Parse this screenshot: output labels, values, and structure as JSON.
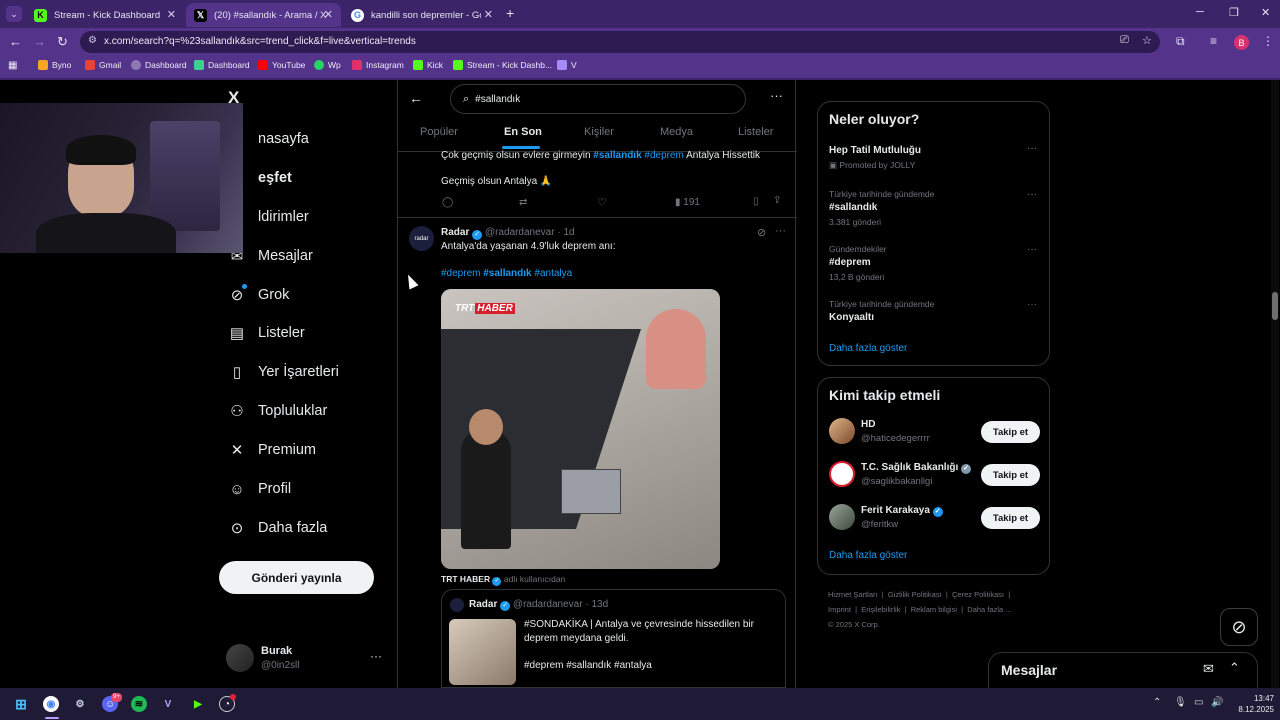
{
  "browser": {
    "tabs": [
      {
        "title": "Stream - Kick Dashboard",
        "active": false
      },
      {
        "title": "(20) #sallandık - Arama / X",
        "active": true
      },
      {
        "title": "kandilli son depremler - Google",
        "active": false
      }
    ],
    "url": "x.com/search?q=%23sallandık&src=trend_click&f=live&vertical=trends",
    "profile_initial": "B",
    "bookmarks": [
      "Byno",
      "Gmail",
      "Dashboard",
      "Dashboard",
      "YouTube",
      "Wp",
      "Instagram",
      "Kick",
      "Stream - Kick Dashb...",
      "V"
    ]
  },
  "sidebar": {
    "logo": "X",
    "items": [
      {
        "label": "nasayfa",
        "icon": "home-icon"
      },
      {
        "label": "eşfet",
        "icon": "search-icon"
      },
      {
        "label": "ldirimler",
        "icon": "bell-icon"
      },
      {
        "label": "Mesajlar",
        "icon": "mail-icon"
      },
      {
        "label": "Grok",
        "icon": "grok-icon"
      },
      {
        "label": "Listeler",
        "icon": "list-icon"
      },
      {
        "label": "Yer İşaretleri",
        "icon": "bookmark-icon"
      },
      {
        "label": "Topluluklar",
        "icon": "communities-icon"
      },
      {
        "label": "Premium",
        "icon": "x-premium-icon"
      },
      {
        "label": "Profil",
        "icon": "profile-icon"
      },
      {
        "label": "Daha fazla",
        "icon": "more-icon"
      }
    ],
    "post_button": "Gönderi yayınla",
    "account": {
      "name": "Burak",
      "handle": "@0in2sll"
    }
  },
  "search": {
    "query": "#sallandık",
    "tabs": [
      "Popüler",
      "En Son",
      "Kişiler",
      "Medya",
      "Listeler"
    ],
    "active_tab": "En Son"
  },
  "feed": {
    "prev_tweet": {
      "line1_prefix": "Çok geçmiş olsun evlere girmeyin ",
      "line1_tag1": "#sallandık",
      "line1_tag2": "#deprem",
      "line1_suffix": " Antalya Hissettik",
      "line2": "Geçmiş olsun Antalya 🙏",
      "views": "191"
    },
    "tweet": {
      "name": "Radar",
      "handle": "@radardanevar",
      "time": "1d",
      "avatar_text": "radar",
      "text": "Antalya'da yaşanan 4.9'luk deprem anı:",
      "tags": [
        "#deprem",
        "#sallandık",
        "#antalya"
      ],
      "media_badge_1": "TRT",
      "media_badge_2": "HABER",
      "from_user": "TRT HABER",
      "from_note": "adlı kullanıcıdan",
      "quote": {
        "name": "Radar",
        "handle": "@radardanevar",
        "time": "13d",
        "line1": "#SONDAKİKA | Antalya ve çevresinde hissedilen bir",
        "line2": "deprem meydana geldi.",
        "tags": "#deprem #sallandık #antalya"
      }
    }
  },
  "trends": {
    "title": "Neler oluyor?",
    "items": [
      {
        "meta": "",
        "name": "Hep Tatil Mutluluğu",
        "sub": "Promoted by JOLLY"
      },
      {
        "meta": "Türkiye tarihinde gündemde",
        "name": "#sallandık",
        "sub": "3.381 gönderi"
      },
      {
        "meta": "Gündemdekiler",
        "name": "#deprem",
        "sub": "13,2 B gönderi"
      },
      {
        "meta": "Türkiye tarihinde gündemde",
        "name": "Konyaaltı",
        "sub": ""
      }
    ],
    "more": "Daha fazla göster"
  },
  "who_to_follow": {
    "title": "Kimi takip etmeli",
    "users": [
      {
        "name": "HD",
        "handle": "@haticedegerrrr"
      },
      {
        "name": "T.C. Sağlık Bakanlığı",
        "handle": "@saglikbakanligi"
      },
      {
        "name": "Ferit Karakaya",
        "handle": "@feritkw"
      }
    ],
    "follow_label": "Takip et",
    "more": "Daha fazla göster"
  },
  "footer": {
    "links": [
      "Hizmet Şartları",
      "Gizlilik Politikası",
      "Çerez Politikası",
      "Imprint",
      "Erişilebilirlik",
      "Reklam bilgisi",
      "Daha fazla ..."
    ],
    "copyright": "© 2025 X Corp."
  },
  "messages_drawer": {
    "title": "Mesajlar"
  },
  "taskbar": {
    "time": "13:47",
    "date": "8.12.2025",
    "discord_badge": "9+"
  }
}
